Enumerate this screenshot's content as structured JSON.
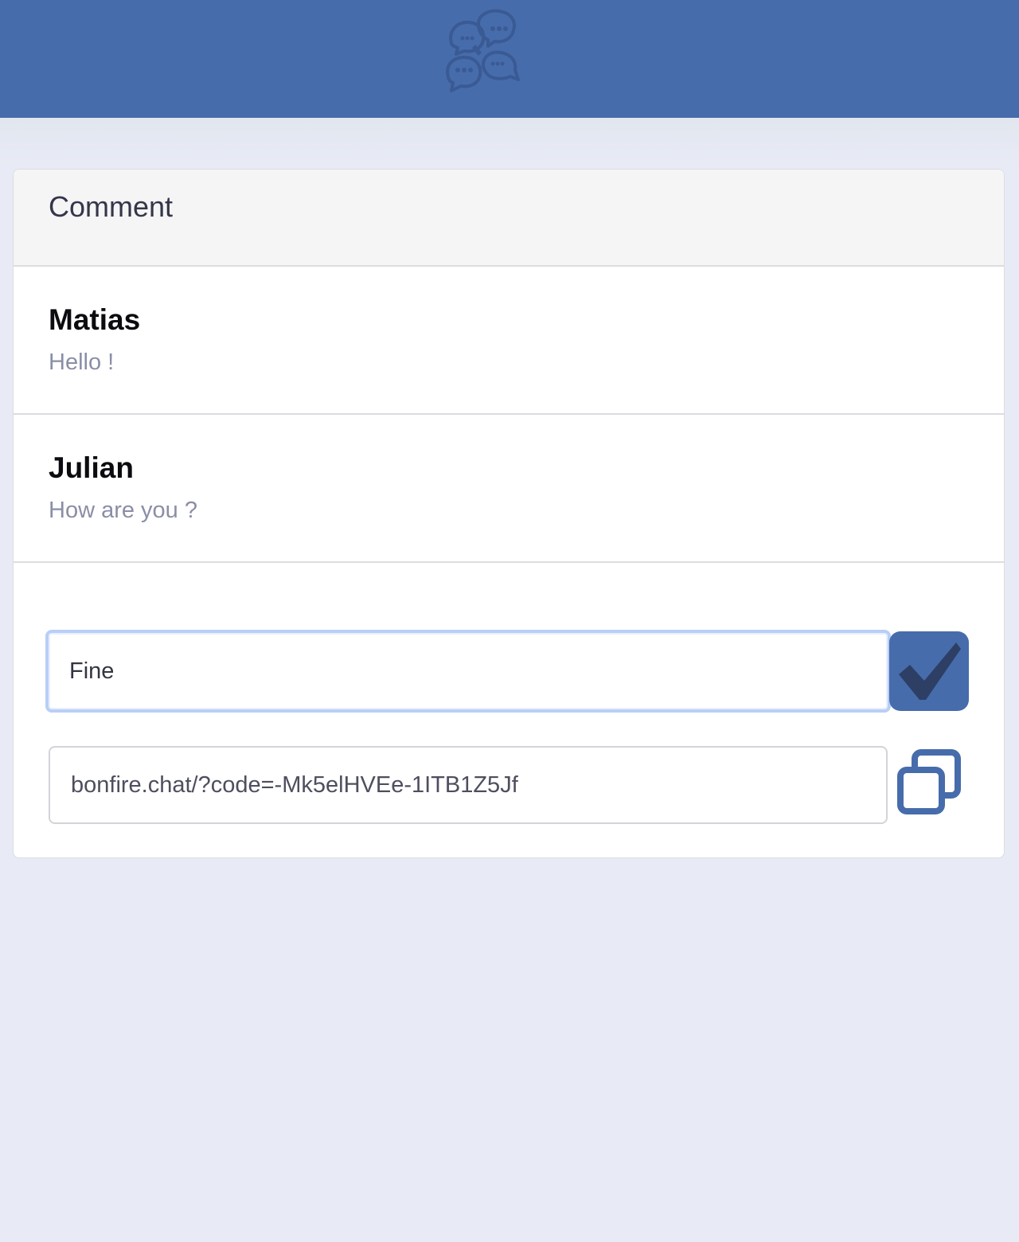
{
  "app": {
    "logo_icon": "chat-bubbles-icon",
    "brand_color": "#476cab"
  },
  "panel": {
    "title": "Comment"
  },
  "comments": [
    {
      "author": "Matias",
      "text": "Hello !"
    },
    {
      "author": "Julian",
      "text": "How are you ?"
    }
  ],
  "composer": {
    "value": "Fine",
    "send_icon": "checkmark-icon"
  },
  "share": {
    "link": "bonfire.chat/?code=-Mk5elHVEe-1ITB1Z5Jf",
    "copy_icon": "copy-icon"
  }
}
